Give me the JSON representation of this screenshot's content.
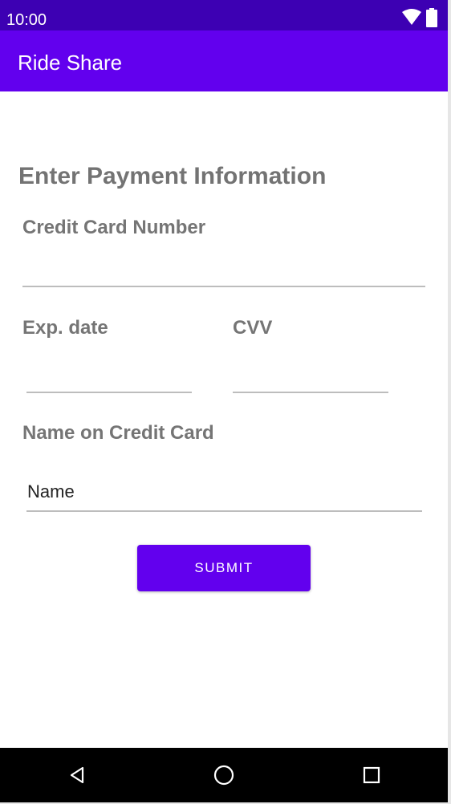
{
  "status_bar": {
    "time": "10:00",
    "icons": [
      "wifi-icon",
      "battery-icon"
    ]
  },
  "app_bar": {
    "title": "Ride Share"
  },
  "form": {
    "heading": "Enter Payment Information",
    "card_number_label": "Credit Card Number",
    "card_number_value": "",
    "exp_date_label": "Exp. date",
    "exp_date_value": "",
    "cvv_label": "CVV",
    "cvv_value": "",
    "name_label": "Name on Credit Card",
    "name_placeholder": "Name",
    "submit_label": "SUBMIT"
  },
  "nav_bar": {
    "icons": [
      "back-icon",
      "home-icon",
      "recents-icon"
    ]
  },
  "colors": {
    "status_bar": "#3d00b3",
    "app_bar": "#6200ee",
    "button": "#6200ee",
    "label": "#757575"
  }
}
